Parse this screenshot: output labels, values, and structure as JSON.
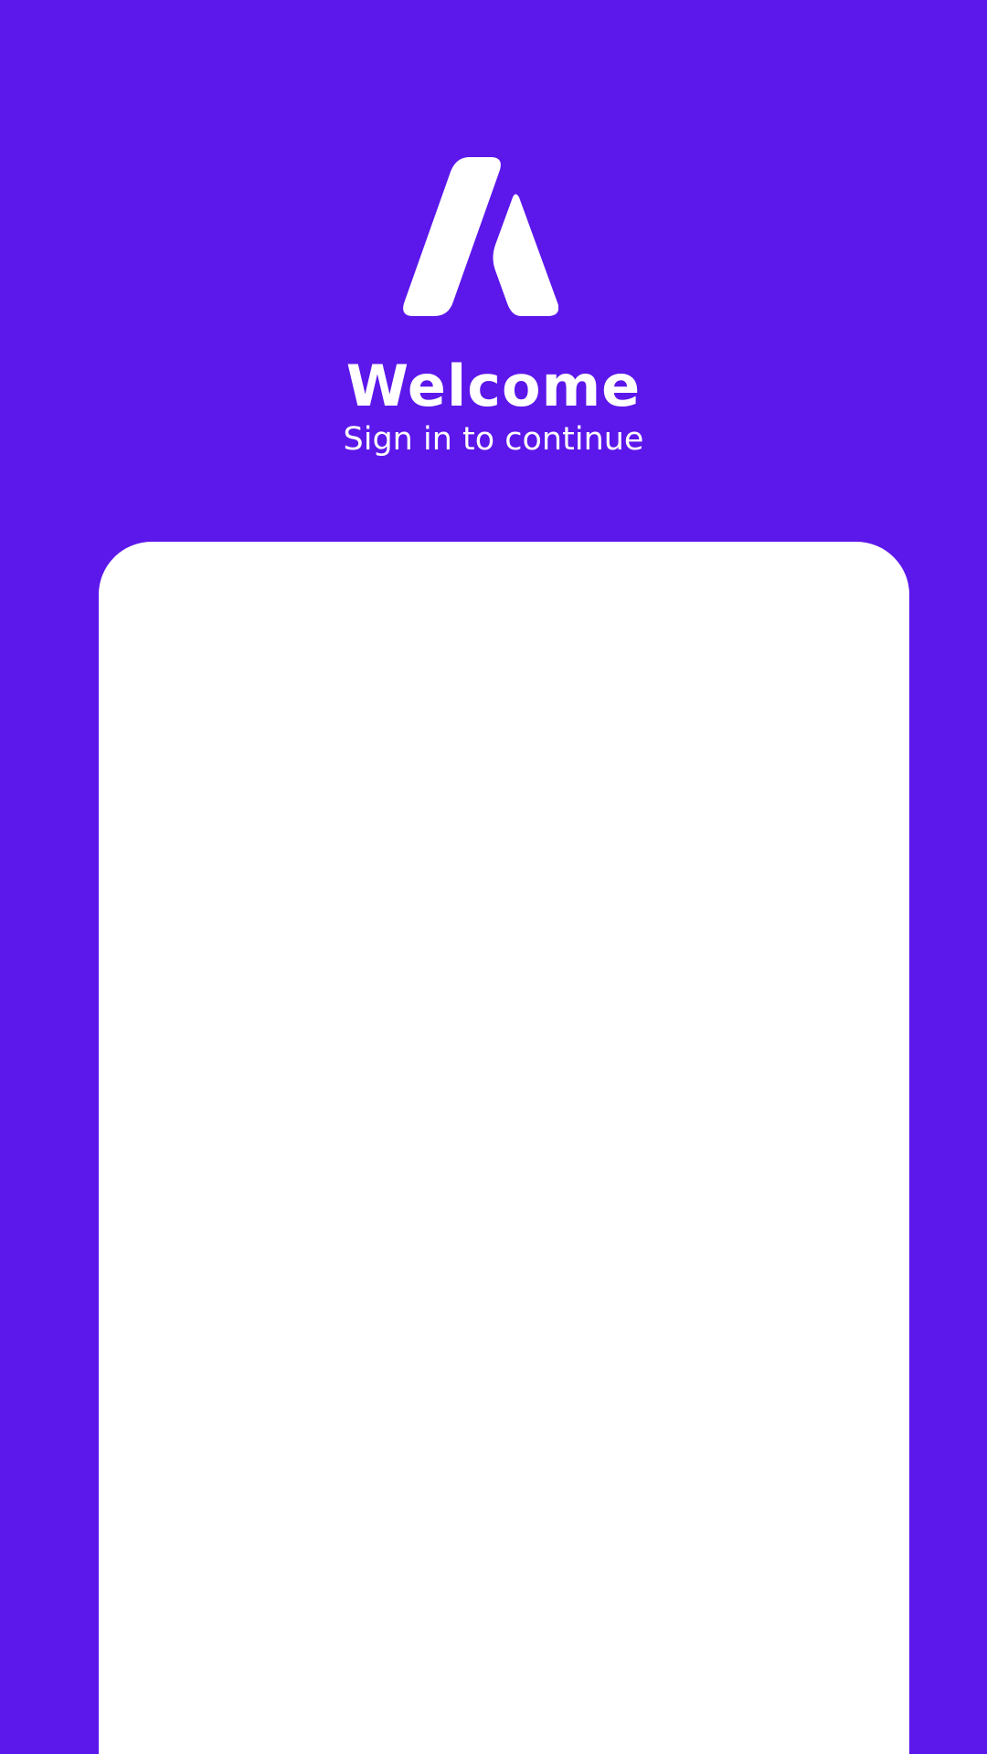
{
  "app": {
    "logo_icon": "app-logo-a-icon",
    "title": "Welcome",
    "subtitle": "Sign in to continue"
  },
  "colors": {
    "background": "#5c17eb",
    "text": "#ffffff",
    "card": "#ffffff"
  }
}
